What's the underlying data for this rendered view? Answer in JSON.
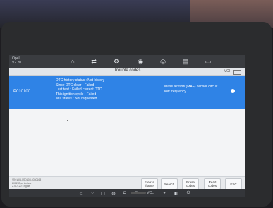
{
  "app": {
    "vehicle_lines": [
      "Opel",
      "V2.20"
    ],
    "screen_title": "Trouble codes",
    "status_vci": "VCI"
  },
  "toolbar": {
    "icons": [
      "home-icon",
      "swap-icon",
      "settings-icon",
      "car-icon",
      "globe-icon",
      "print-icon",
      "message-icon"
    ]
  },
  "dtc": {
    "code": "P010100",
    "status_lines": [
      "DTC history status : Not history",
      "Since DTC clear : Failed",
      "Last test : Failed current DTC",
      "This ignition cycle : Failed",
      "MIL status : Not requested"
    ],
    "description_lines": [
      "Mass air flow (MAF) sensor circuit",
      "low frequency"
    ]
  },
  "footer": {
    "info_lines": [
      "VIN:W0L0SDL08.4030163",
      "2012 Opel Antara",
      "2.4L/L20 Engine"
    ],
    "buttons": [
      "Freeze frame",
      "Search",
      "Erase codes",
      "Read codes",
      "ESC"
    ]
  },
  "navbar": {
    "icons": [
      "back-icon",
      "home-icon",
      "recent-apps-icon",
      "browser-icon",
      "camera-icon",
      "display-icon",
      "vcl-icon",
      "car-icon",
      "shop-icon",
      "power-icon"
    ],
    "vcl_label": "VCL"
  }
}
